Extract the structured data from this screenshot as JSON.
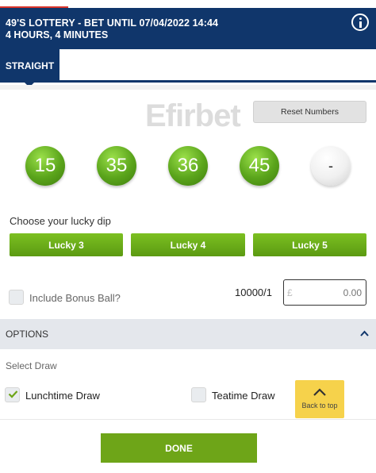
{
  "header": {
    "line1": "49'S LOTTERY  - BET UNTIL  07/04/2022 14:44",
    "line2": "4 HOURS, 4  MINUTES",
    "info_icon": "info-icon"
  },
  "tabs": [
    {
      "label": "STRAIGHT",
      "active": true
    }
  ],
  "logo_text": "Efirbet",
  "reset_label": "Reset Numbers",
  "balls": [
    "15",
    "35",
    "36",
    "45",
    "-"
  ],
  "lucky": {
    "label": "Choose your lucky dip",
    "buttons": [
      "Lucky 3",
      "Lucky 4",
      "Lucky 5"
    ]
  },
  "bonus": {
    "label": "Include Bonus Ball?",
    "checked": false,
    "odds": "10000/1",
    "stake_currency": "£",
    "stake_placeholder": "0.00"
  },
  "options": {
    "label": "OPTIONS",
    "select_label": "Select Draw",
    "draws": [
      {
        "label": "Lunchtime Draw",
        "checked": true
      },
      {
        "label": "Teatime Draw",
        "checked": false
      }
    ]
  },
  "back_to_top": "Back to top",
  "done_label": "DONE",
  "colors": {
    "navy": "#10366b",
    "green": "#6ea518",
    "yellow": "#f6d24b"
  }
}
